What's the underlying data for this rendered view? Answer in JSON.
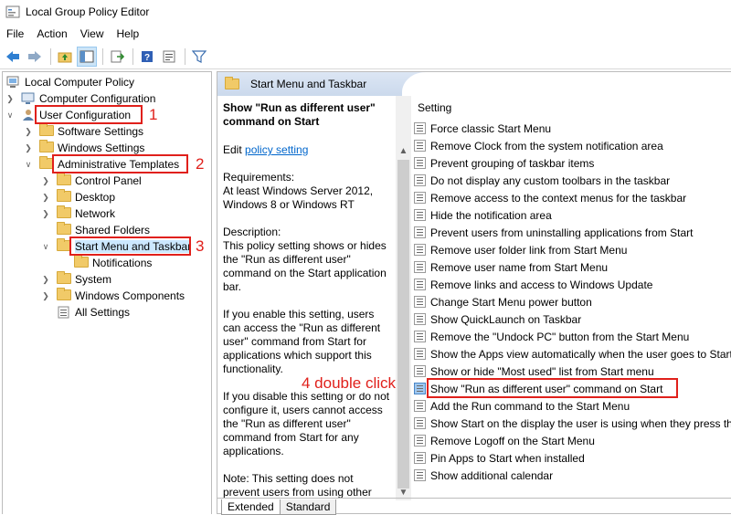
{
  "window": {
    "title": "Local Group Policy Editor"
  },
  "menu": [
    "File",
    "Action",
    "View",
    "Help"
  ],
  "toolbar": [
    "back-icon",
    "forward-icon",
    "up-folder-icon",
    "show-hide-tree-icon",
    "export-list-icon",
    "help-icon",
    "properties-icon",
    "filter-icon"
  ],
  "tree": [
    {
      "label": "Local Computer Policy"
    },
    {
      "label": "Computer Configuration"
    },
    {
      "label": "User Configuration"
    },
    {
      "label": "Software Settings"
    },
    {
      "label": "Windows Settings"
    },
    {
      "label": "Administrative Templates"
    },
    {
      "label": "Control Panel"
    },
    {
      "label": "Desktop"
    },
    {
      "label": "Network"
    },
    {
      "label": "Shared Folders"
    },
    {
      "label": "Start Menu and Taskbar"
    },
    {
      "label": "Notifications"
    },
    {
      "label": "System"
    },
    {
      "label": "Windows Components"
    },
    {
      "label": "All Settings"
    }
  ],
  "annotations": {
    "n1": "1",
    "n2": "2",
    "n3": "3",
    "n4": "4 double click"
  },
  "pane": {
    "header": "Start Menu and Taskbar",
    "desc_title": "Show \"Run as different user\" command on Start",
    "edit_prefix": "Edit ",
    "edit_link": "policy setting",
    "requirements": "Requirements:\nAt least Windows Server 2012, Windows 8 or Windows RT",
    "description": "Description:\nThis policy setting shows or hides the \"Run as different user\" command on the Start application bar.",
    "p_enable": "If you enable this setting, users can access the \"Run as different user\" command from Start for applications which support this functionality.",
    "p_disable": "If you disable this setting or do not configure it, users cannot access the \"Run as different user\" command from Start for any applications.",
    "p_note": "Note: This setting does not prevent users from using other",
    "column_header": "Setting",
    "settings": [
      "Force classic Start Menu",
      "Remove Clock from the system notification area",
      "Prevent grouping of taskbar items",
      "Do not display any custom toolbars in the taskbar",
      "Remove access to the context menus for the taskbar",
      "Hide the notification area",
      "Prevent users from uninstalling applications from Start",
      "Remove user folder link from Start Menu",
      "Remove user name from Start Menu",
      "Remove links and access to Windows Update",
      "Change Start Menu power button",
      "Show QuickLaunch on Taskbar",
      "Remove the \"Undock PC\" button from the Start Menu",
      "Show the Apps view automatically when the user goes to Start",
      "Show or hide \"Most used\" list from Start menu",
      "Show \"Run as different user\" command on Start",
      "Add the Run command to the Start Menu",
      "Show Start on the display the user is using when they press the Windows logo key",
      "Remove Logoff on the Start Menu",
      "Pin Apps to Start when installed",
      "Show additional calendar"
    ],
    "tabs": [
      "Extended",
      "Standard"
    ]
  },
  "colors": {
    "annotation": "#e0201b",
    "link": "#0066cc",
    "header": "#dce6f4"
  }
}
